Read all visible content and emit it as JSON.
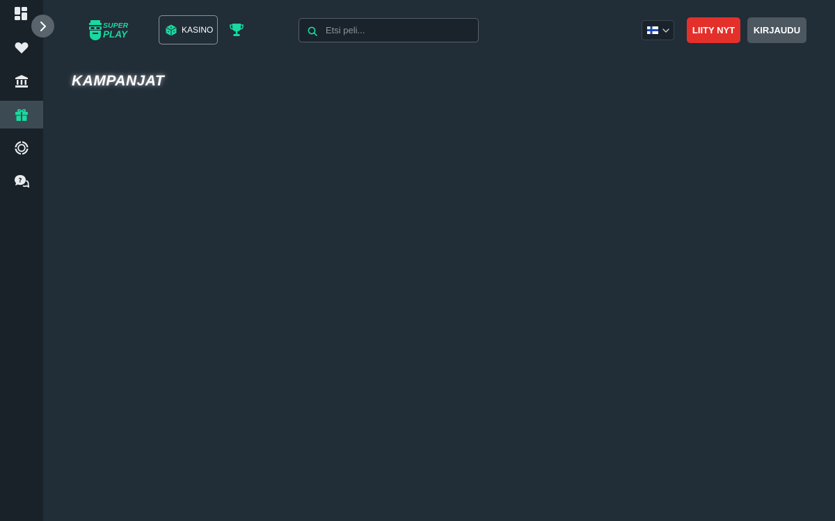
{
  "colors": {
    "background": "#212d37",
    "sidebar": "#192129",
    "accent": "#19d9a0",
    "join_button": "#e4302a",
    "login_button": "#4c5760"
  },
  "sidebar": {
    "items": [
      {
        "name": "dashboard",
        "icon": "grid-icon",
        "active": false
      },
      {
        "name": "favorites",
        "icon": "heart-icon",
        "active": false
      },
      {
        "name": "casino",
        "icon": "bank-icon",
        "active": false
      },
      {
        "name": "promotions",
        "icon": "gift-icon",
        "active": true
      },
      {
        "name": "live",
        "icon": "chip-icon",
        "active": false
      },
      {
        "name": "support",
        "icon": "chat-question-icon",
        "active": false
      }
    ],
    "expand_icon": "chevron-right-icon"
  },
  "header": {
    "logo_text_top": "SUPER",
    "logo_text_bottom": "PLAY",
    "nav": {
      "casino_label": "KASINO",
      "casino_icon": "cube-icon",
      "trophy_icon": "trophy-icon"
    },
    "search": {
      "placeholder": "Etsi peli...",
      "value": "",
      "icon": "search-icon"
    },
    "language": {
      "selected": "fi",
      "icon": "finland-flag-icon"
    },
    "join_label": "LIITY NYT",
    "login_label": "KIRJAUDU"
  },
  "main": {
    "title": "KAMPANJAT"
  }
}
